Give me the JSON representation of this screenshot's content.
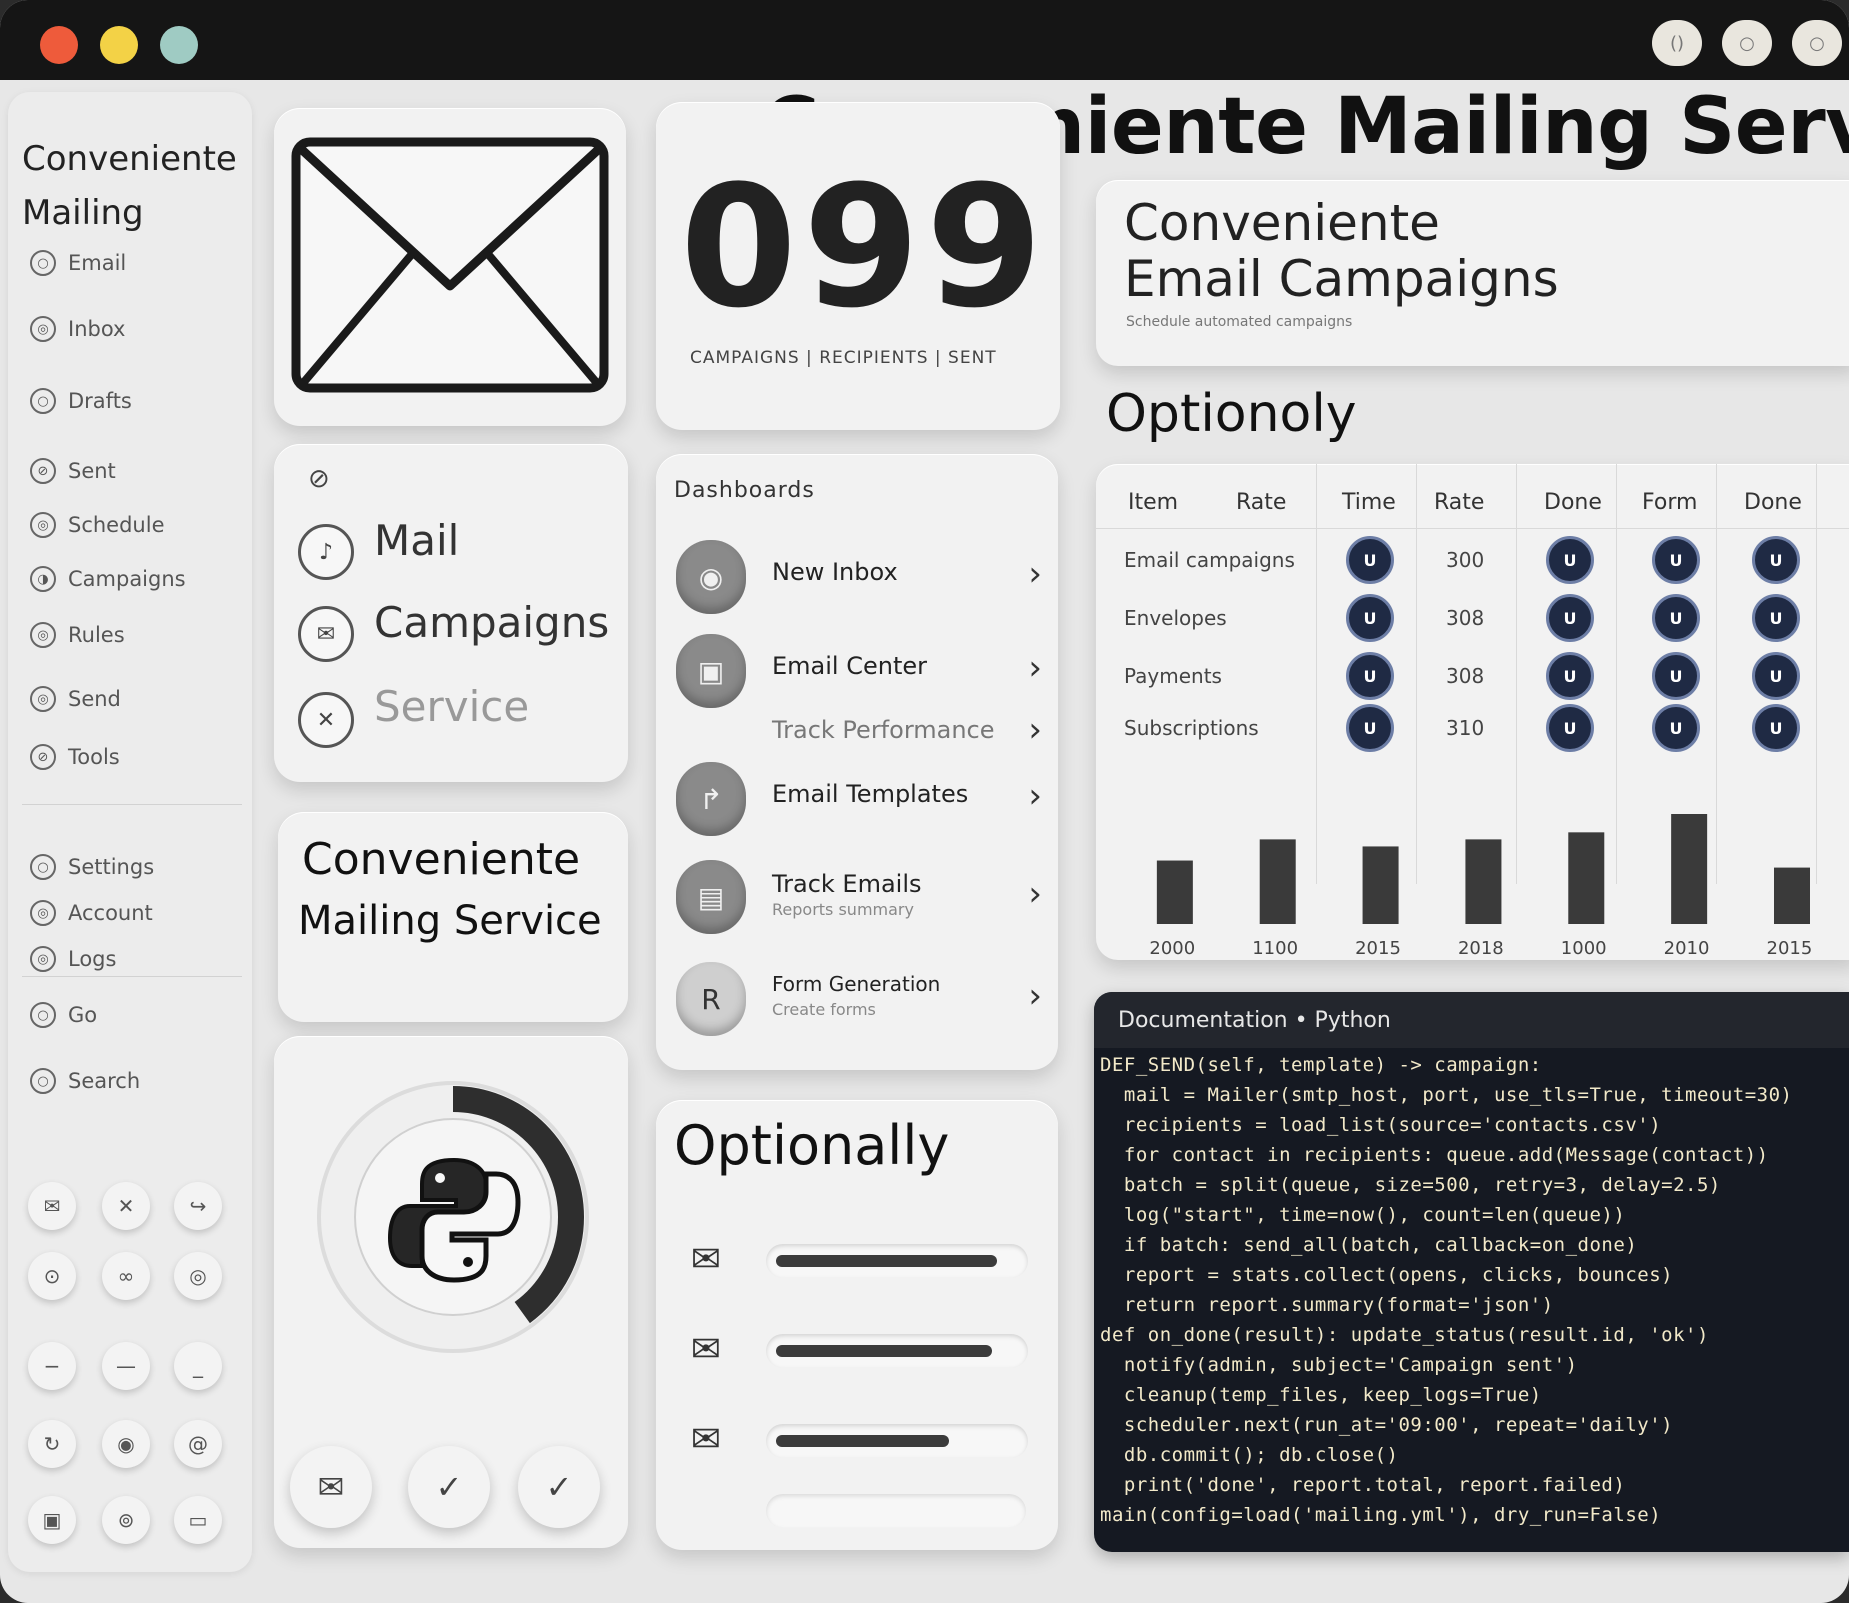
{
  "window": {
    "title_buttons": [
      "()",
      "○",
      "○"
    ]
  },
  "header": {
    "title": "Conveniente Mailing Service"
  },
  "sidebar": {
    "title_line1": "Conveniente",
    "title_line2": "Mailing",
    "items": [
      {
        "icon": "○",
        "label": "Email"
      },
      {
        "icon": "◎",
        "label": "Inbox"
      },
      {
        "icon": "○",
        "label": "Drafts"
      },
      {
        "icon": "⊘",
        "label": "Sent"
      },
      {
        "icon": "◎",
        "label": "Schedule"
      },
      {
        "icon": "◑",
        "label": "Campaigns"
      },
      {
        "icon": "◎",
        "label": "Rules"
      },
      {
        "icon": "◎",
        "label": "Send"
      },
      {
        "icon": "⊘",
        "label": "Tools"
      },
      {
        "icon": "○",
        "label": "Settings"
      },
      {
        "icon": "◎",
        "label": "Account"
      },
      {
        "icon": "◎",
        "label": "Logs"
      }
    ],
    "footer_items": [
      {
        "icon": "○",
        "label": "Go"
      },
      {
        "icon": "○",
        "label": "Search"
      }
    ]
  },
  "envelope_card": {
    "icon": "envelope-icon"
  },
  "counter": {
    "value": "099",
    "labels": "CAMPAIGNS | RECIPIENTS | SENT"
  },
  "nav_card": {
    "top_icon": "⊘",
    "items": [
      {
        "icon": "♪",
        "label": "Mail"
      },
      {
        "icon": "✉",
        "label": "Campaigns"
      },
      {
        "icon": "✕",
        "label": "Service"
      }
    ]
  },
  "brand_card": {
    "line1": "Conveniente",
    "line2": "Mailing Service"
  },
  "dashboard_card": {
    "title": "Dashboards",
    "rows": [
      {
        "icon": "◉",
        "label": "New Inbox",
        "sub": ""
      },
      {
        "icon": "▣",
        "label": "Email Center",
        "sub": ""
      },
      {
        "icon": "",
        "label": "Track Performance",
        "sub": ""
      },
      {
        "icon": "↱",
        "label": "Email Templates",
        "sub": ""
      },
      {
        "icon": "▤",
        "label": "Track Emails",
        "sub": "Reports summary"
      },
      {
        "icon": "R",
        "label": "Form Generation",
        "sub": "Create forms"
      }
    ]
  },
  "campaigns_card": {
    "line1": "Conveniente",
    "line2": "Email Campaigns",
    "caption": "Schedule automated campaigns"
  },
  "optional_label": "Optionoly",
  "table": {
    "columns": [
      "Item",
      "Rate",
      "Time",
      "Rate",
      "Done",
      "Form",
      "Done"
    ],
    "rows": [
      {
        "name": "Email campaigns",
        "value": "300",
        "badges": [
          "U",
          "U",
          "U",
          "U",
          "U"
        ]
      },
      {
        "name": "Envelopes",
        "value": "308",
        "badges": [
          "U",
          "U",
          "U",
          "U",
          "U"
        ]
      },
      {
        "name": "Payments",
        "value": "308",
        "badges": [
          "U",
          "U",
          "U",
          "U",
          "U"
        ]
      },
      {
        "name": "Subscriptions",
        "value": "310",
        "badges": [
          "U",
          "U",
          "U",
          "U",
          "U"
        ]
      }
    ],
    "x_labels": [
      "2000",
      "1100",
      "2015",
      "2018",
      "1000",
      "2010",
      "2015"
    ]
  },
  "chart_data": {
    "type": "bar",
    "categories": [
      "2000",
      "1100",
      "2015",
      "2018",
      "1000",
      "2010",
      "2015"
    ],
    "values": [
      45,
      60,
      55,
      60,
      65,
      78,
      40
    ],
    "title": "",
    "xlabel": "",
    "ylabel": ""
  },
  "python_card": {
    "icon": "python-icon",
    "progress_percent": 40,
    "buttons": [
      {
        "icon": "✉",
        "name": "compose"
      },
      {
        "icon": "✓",
        "name": "approve"
      },
      {
        "icon": "✓",
        "name": "send"
      }
    ]
  },
  "optionally_card": {
    "title": "Optionally",
    "sliders": [
      {
        "icon": "✉",
        "percent": 0.92
      },
      {
        "icon": "✉",
        "percent": 0.9
      },
      {
        "icon": "✉",
        "percent": 0.72
      }
    ]
  },
  "code_panel": {
    "header": "Documentation  •  Python",
    "lines": [
      "DEF_SEND(self, template) -> campaign:",
      "  mail = Mailer(smtp_host, port, use_tls=True, timeout=30)",
      "  recipients = load_list(source='contacts.csv')",
      "  for contact in recipients: queue.add(Message(contact))",
      "  batch = split(queue, size=500, retry=3, delay=2.5)",
      "  log(\"start\", time=now(), count=len(queue))",
      "  if batch: send_all(batch, callback=on_done)",
      "  report = stats.collect(opens, clicks, bounces)",
      "  return report.summary(format='json')",
      "def on_done(result): update_status(result.id, 'ok')",
      "  notify(admin, subject='Campaign sent')",
      "  cleanup(temp_files, keep_logs=True)",
      "  scheduler.next(run_at='09:00', repeat='daily')",
      "  db.commit(); db.close()",
      "  print('done', report.total, report.failed)",
      "main(config=load('mailing.yml'), dry_run=False)"
    ]
  }
}
